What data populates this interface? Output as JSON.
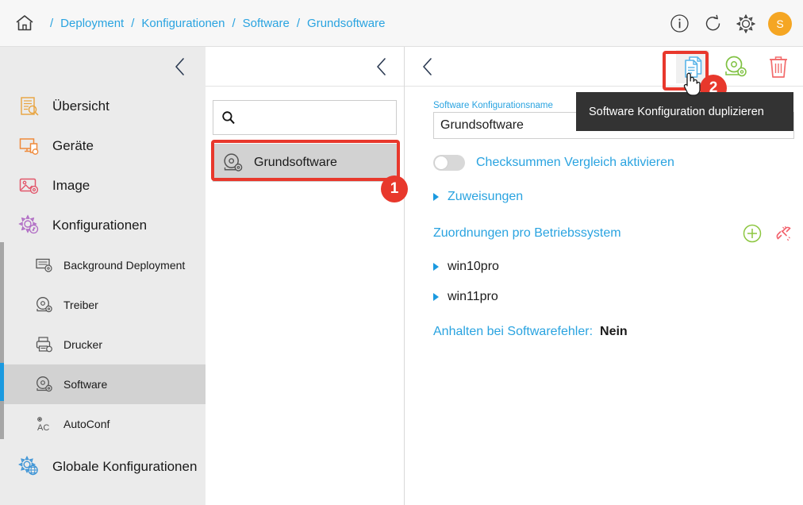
{
  "breadcrumb": {
    "home_icon": "home-icon",
    "items": [
      "Deployment",
      "Konfigurationen",
      "Software",
      "Grundsoftware"
    ],
    "separator": "/"
  },
  "topbar": {
    "info_icon": "info-icon",
    "refresh_icon": "refresh-icon",
    "settings_icon": "gear-icon",
    "avatar_initial": "S",
    "avatar_color": "#f5a623"
  },
  "sidebar": {
    "collapse_icon": "chevron-left-icon",
    "items": [
      {
        "label": "Übersicht",
        "icon": "overview-icon"
      },
      {
        "label": "Geräte",
        "icon": "devices-icon"
      },
      {
        "label": "Image",
        "icon": "image-icon"
      },
      {
        "label": "Konfigurationen",
        "icon": "configurations-gear-icon"
      }
    ],
    "sub_items": [
      {
        "label": "Background Deployment",
        "icon": "background-deployment-icon",
        "active": false
      },
      {
        "label": "Treiber",
        "icon": "driver-disc-icon",
        "active": false
      },
      {
        "label": "Drucker",
        "icon": "printer-icon",
        "active": false
      },
      {
        "label": "Software",
        "icon": "software-disc-icon",
        "active": true
      },
      {
        "label": "AutoConf",
        "icon": "autoconf-icon",
        "active": false
      }
    ],
    "footer_item": {
      "label": "Globale Konfigurationen",
      "icon": "global-configurations-icon"
    }
  },
  "middle": {
    "collapse_icon": "chevron-left-icon",
    "search": {
      "placeholder": "",
      "value": "",
      "icon": "search-icon"
    },
    "list": [
      {
        "label": "Grundsoftware",
        "icon": "software-disc-icon",
        "selected": true
      }
    ]
  },
  "right": {
    "back_icon": "chevron-left-icon",
    "toolbar": [
      {
        "name": "duplicate-button",
        "icon": "duplicate-documents-icon",
        "highlighted": true
      },
      {
        "name": "software-button",
        "icon": "software-disc-icon",
        "highlighted": false
      },
      {
        "name": "delete-button",
        "icon": "trash-icon",
        "highlighted": false
      }
    ],
    "name_field": {
      "label": "Software Konfigurationsname",
      "value": "Grundsoftware"
    },
    "checksum_toggle": {
      "label": "Checksummen Vergleich aktivieren",
      "enabled": false
    },
    "assignments_expander": {
      "label": "Zuweisungen",
      "expanded": false
    },
    "os_section": {
      "title": "Zuordnungen pro Betriebssystem",
      "add_icon": "plus-circle-icon",
      "unlink_icon": "broken-link-icon",
      "items": [
        {
          "label": "win10pro",
          "expanded": false
        },
        {
          "label": "win11pro",
          "expanded": false
        }
      ]
    },
    "halt_on_error": {
      "key": "Anhalten bei Softwarefehler:",
      "value": "Nein"
    }
  },
  "tooltip": {
    "text": "Software Konfiguration duplizieren"
  },
  "annotations": [
    {
      "badge": "1",
      "target": "grundsoftware-list-item"
    },
    {
      "badge": "2",
      "target": "duplicate-button"
    }
  ],
  "colors": {
    "accent_blue": "#29a3e0",
    "annotation_red": "#e8382c",
    "avatar_orange": "#f5a623"
  }
}
